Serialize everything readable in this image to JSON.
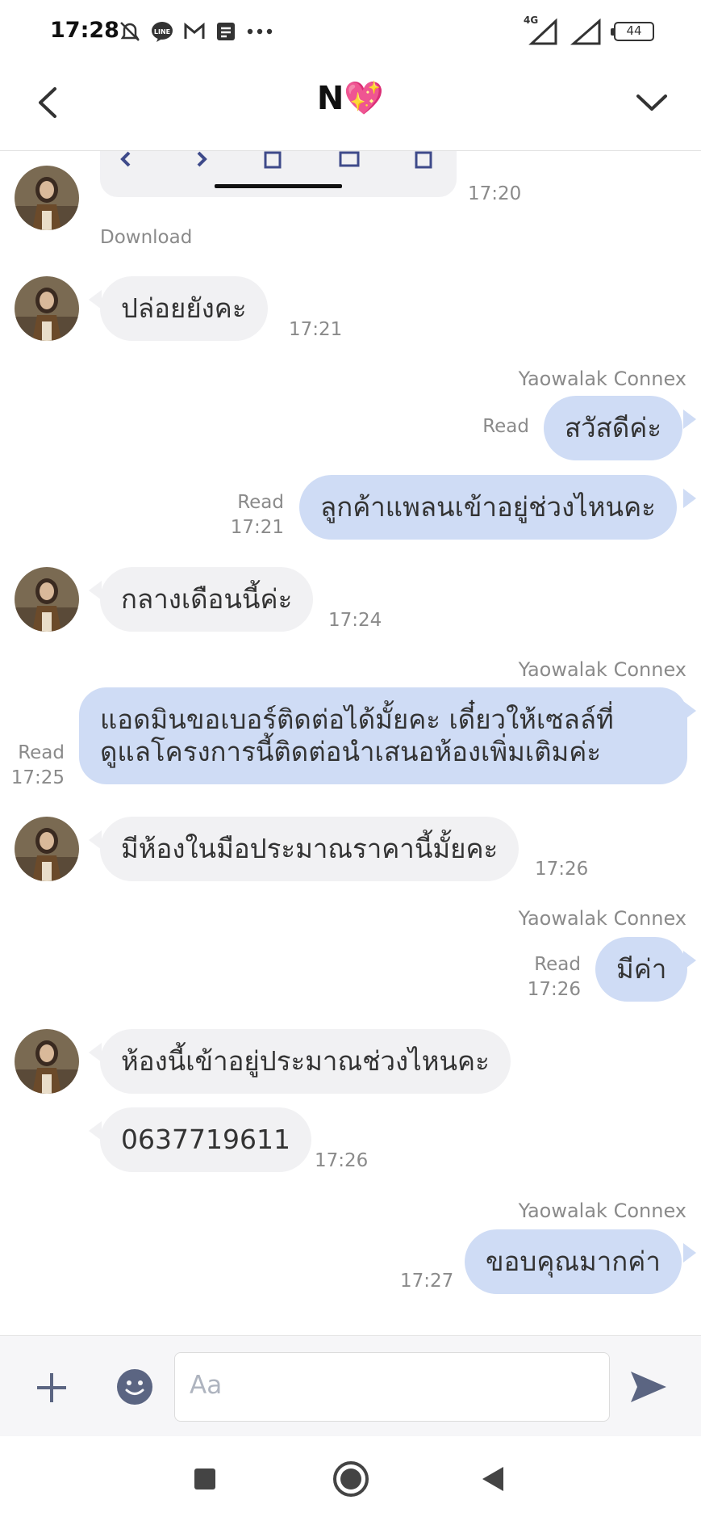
{
  "status_bar": {
    "time": "17:28",
    "network": "4G",
    "battery": "44",
    "icons": [
      "mute-bell-icon",
      "line-icon",
      "gmail-icon",
      "note-icon",
      "more-dots-icon",
      "signal-icon",
      "battery-icon"
    ]
  },
  "header": {
    "title": "N💖"
  },
  "chat": {
    "download_label": "Download",
    "timestamps": {
      "t1": "17:20",
      "t2": "17:21",
      "t3": "17:21",
      "t4": "17:24",
      "t5": "17:25",
      "t6": "17:26",
      "t7": "17:26",
      "t8": "17:26",
      "t9": "17:27"
    },
    "read_label": "Read",
    "sender_name": "Yaowalak Connex",
    "messages": {
      "m1": "ปล่อยยังคะ",
      "m2": "สวัสดีค่ะ",
      "m3": "ลูกค้าแพลนเข้าอยู่ช่วงไหนคะ",
      "m4": "กลางเดือนนี้ค่ะ",
      "m5_line1": "แอดมินขอเบอร์ติดต่อได้มั้ยคะ เดี๋ยวให้เซลล์ที่",
      "m5_line2": "ดูแลโครงการนี้ติดต่อนำเสนอห้องเพิ่มเติมค่ะ",
      "m6": "มีห้องในมือประมาณราคานี้มั้ยคะ",
      "m7": "มีค่า",
      "m8": "ห้องนี้เข้าอยู่ประมาณช่วงไหนคะ",
      "m9": "0637719611",
      "m10": "ขอบคุณมากค่า"
    }
  },
  "composer": {
    "placeholder": "Aa"
  },
  "colors": {
    "outgoing_bubble": "#cfdcf5",
    "incoming_bubble": "#f1f1f3",
    "icon_slate": "#5b6582"
  }
}
